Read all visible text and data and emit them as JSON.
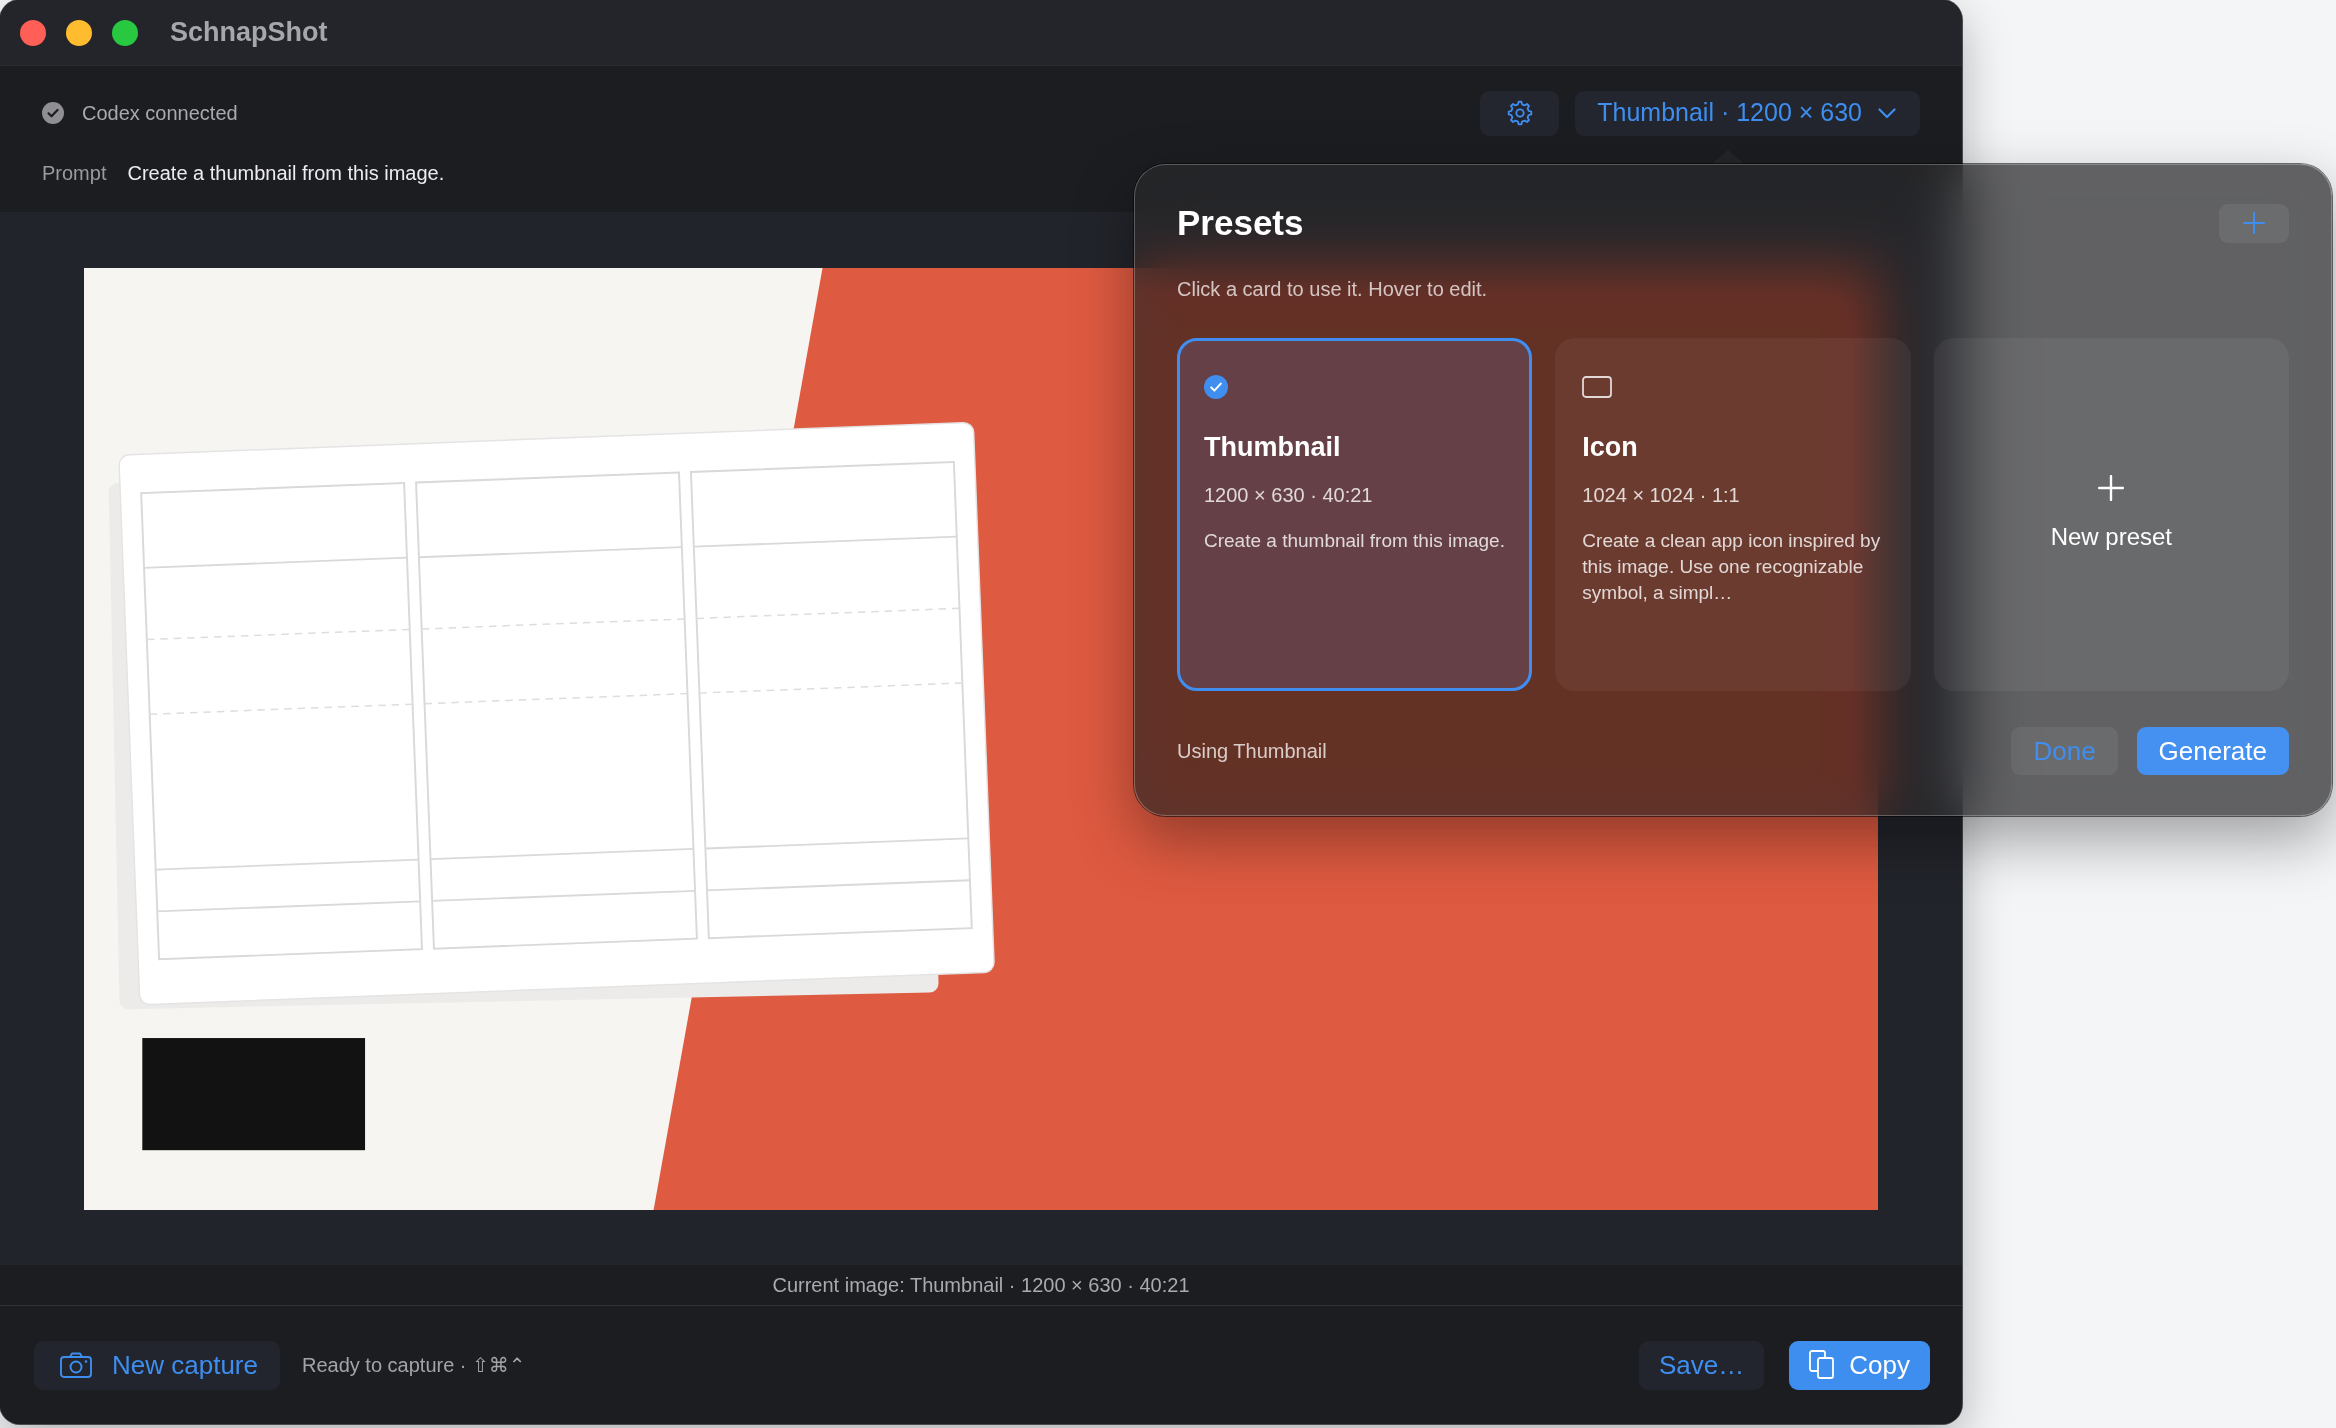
{
  "window": {
    "title": "SchnapShot"
  },
  "toolbar": {
    "status": "Codex connected",
    "preset_menu": {
      "label": "Thumbnail · 1200 × 630",
      "expanded": true
    },
    "prompt": {
      "label": "Prompt",
      "value": "Create a thumbnail from this image."
    }
  },
  "preview": {
    "caption": "Current image: Thumbnail · 1200 × 630 · 40:21"
  },
  "bottom_bar": {
    "new_capture": "New capture",
    "status": "Ready to capture · ⇧⌘⌃",
    "buttons": [
      {
        "label": "Save…",
        "kind": "secondary"
      },
      {
        "label": "Copy",
        "kind": "primary"
      }
    ]
  },
  "presets_popover": {
    "title": "Presets",
    "hint": "Click a card to use it. Hover to edit.",
    "cards": [
      {
        "kind": "preset",
        "name": "Thumbnail",
        "size": "1200 × 630 · 40:21",
        "prompt": "Create a thumbnail from this image.",
        "selected": true
      },
      {
        "kind": "preset",
        "name": "Icon",
        "size": "1024 × 1024 · 1:1",
        "prompt": "Create a clean app icon inspired by this image. Use one recognizable symbol, a simpl…",
        "selected": false
      },
      {
        "kind": "new",
        "label": "New preset"
      }
    ],
    "footer": "Using Thumbnail",
    "buttons": [
      {
        "label": "Done",
        "kind": "secondary"
      },
      {
        "label": "Generate",
        "kind": "primary"
      }
    ]
  }
}
